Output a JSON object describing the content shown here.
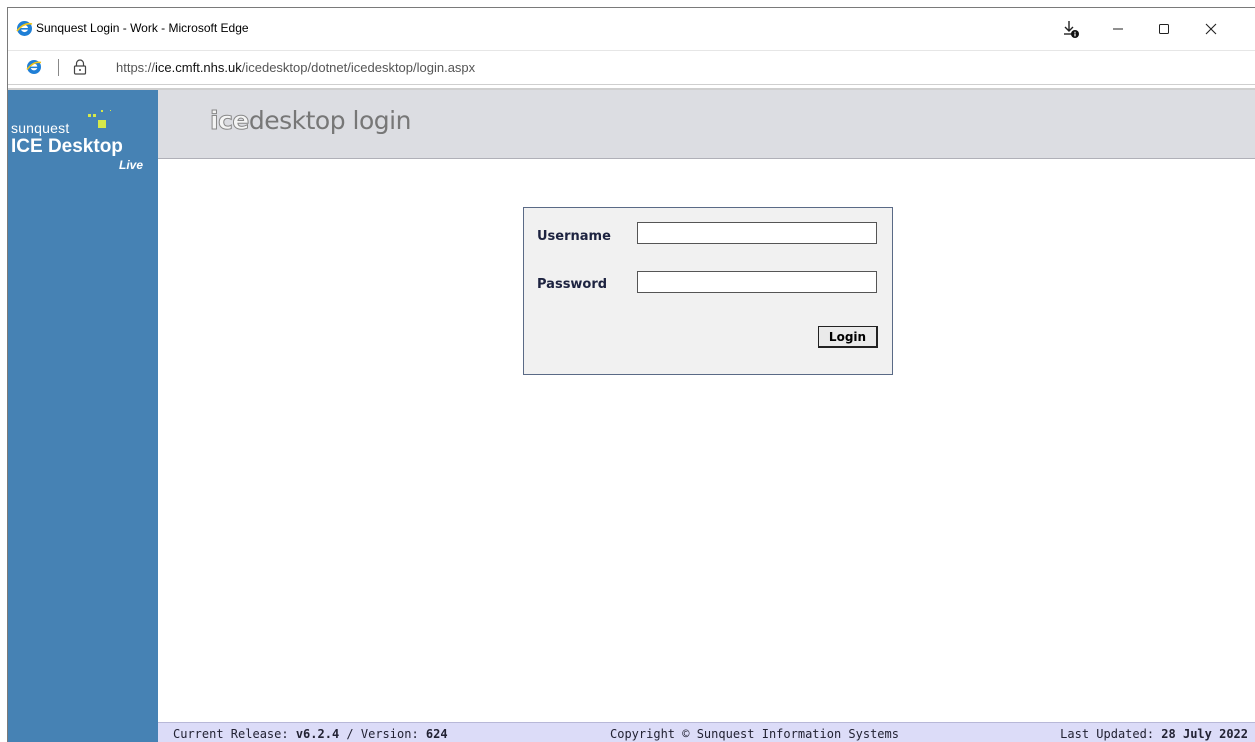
{
  "window": {
    "title": "Sunquest Login - Work - Microsoft Edge",
    "url_prefix": "https://",
    "url_host": "ice.cmft.nhs.uk",
    "url_path": "/icedesktop/dotnet/icedesktop/login.aspx",
    "icons": [
      "edge-ie-icon",
      "download-icon",
      "minimize-icon",
      "maximize-icon",
      "close-icon",
      "lock-icon"
    ]
  },
  "sidebar": {
    "brand_small": "sunquest",
    "brand_big": "ICE Desktop",
    "brand_tag": "Live"
  },
  "header": {
    "title_ice": "ice",
    "title_rest": "desktop login"
  },
  "login": {
    "username_label": "Username",
    "password_label": "Password",
    "username_value": "",
    "password_value": "",
    "button_label": "Login"
  },
  "footer": {
    "release_label": "Current Release:",
    "release_value": "v6.2.4",
    "version_label": "/ Version:",
    "version_value": "624",
    "copyright": "Copyright © Sunquest Information Systems",
    "updated_label": "Last Updated:",
    "updated_value": "28 July 2022"
  },
  "colors": {
    "sidebar": "#4682b4",
    "header": "#dcdde2",
    "footer": "#dcdcf8",
    "logo_accent": "#d6e84a"
  }
}
